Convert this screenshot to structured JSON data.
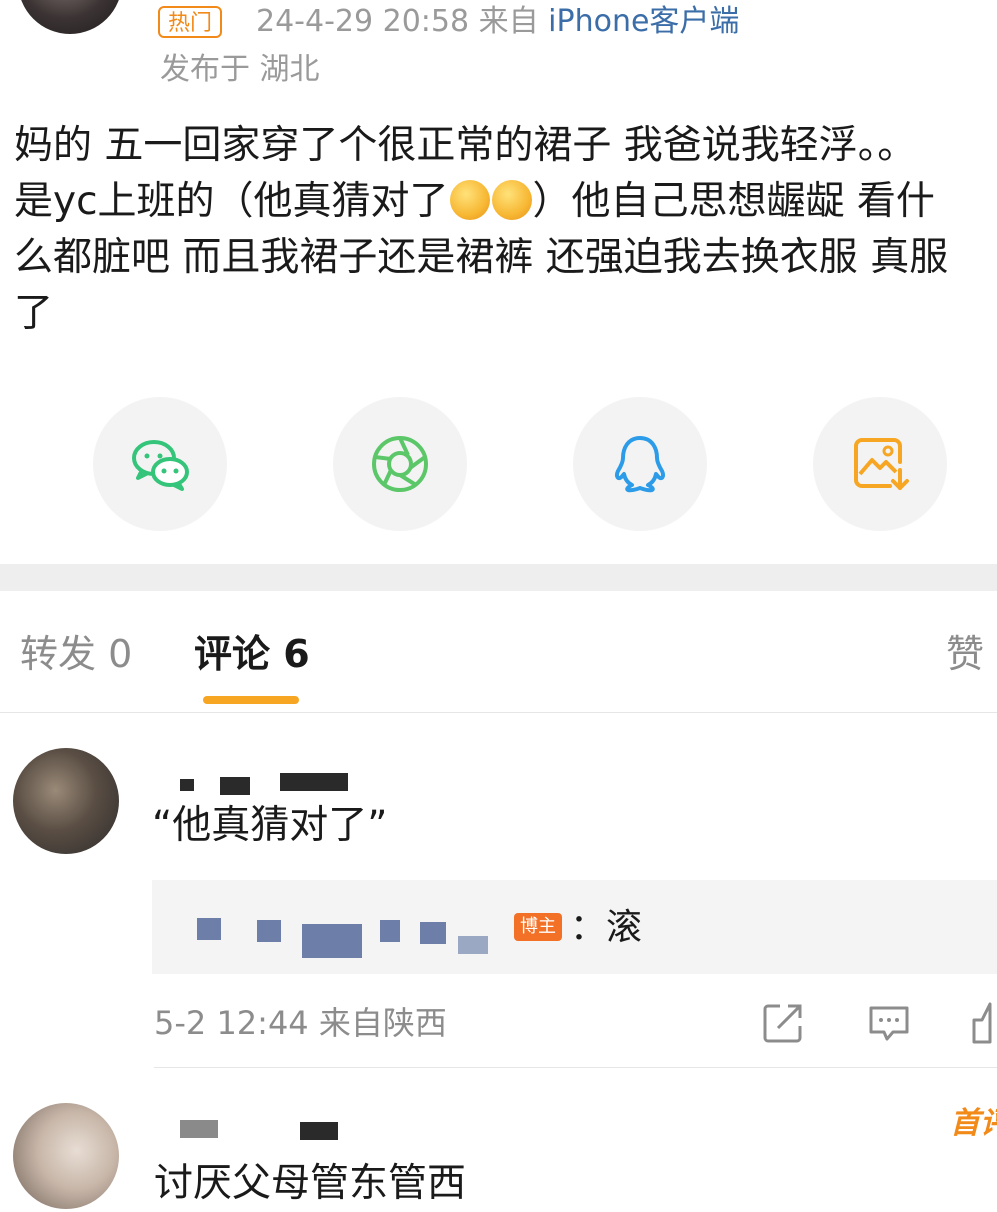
{
  "post": {
    "hot_badge": "热门",
    "time": "24-4-29 20:58",
    "from_label": "来自",
    "client": "iPhone客户端",
    "location": "发布于 湖北",
    "text_before_emoji": "妈的 五一回家穿了个很正常的裙子 我爸说我轻浮。。\n是yc上班的（他真猜对了",
    "text_after_emoji": "）他自己思想龌龊 看什\n么都脏吧 而且我裙子还是裙裤 还强迫我去换衣服 真服\n了"
  },
  "share": {
    "items": [
      {
        "icon": "wechat-icon",
        "color": "#34c47a"
      },
      {
        "icon": "moments-icon",
        "color": "#5cc769"
      },
      {
        "icon": "qq-icon",
        "color": "#2d9ce8"
      },
      {
        "icon": "save-image-icon",
        "color": "#f6a623"
      }
    ]
  },
  "tabs": {
    "repost": "转发 0",
    "comments": "评论 6",
    "likes": "赞",
    "active_color": "#f6a623"
  },
  "comments": [
    {
      "text": "“他真猜对了”",
      "reply_badge": "博主",
      "reply_text": "：滚",
      "meta": "5-2 12:44 来自陕西",
      "actions": [
        "share-icon",
        "comment-icon",
        "like-icon"
      ]
    },
    {
      "text": "讨厌父母管东管西",
      "badge": "首评"
    }
  ]
}
